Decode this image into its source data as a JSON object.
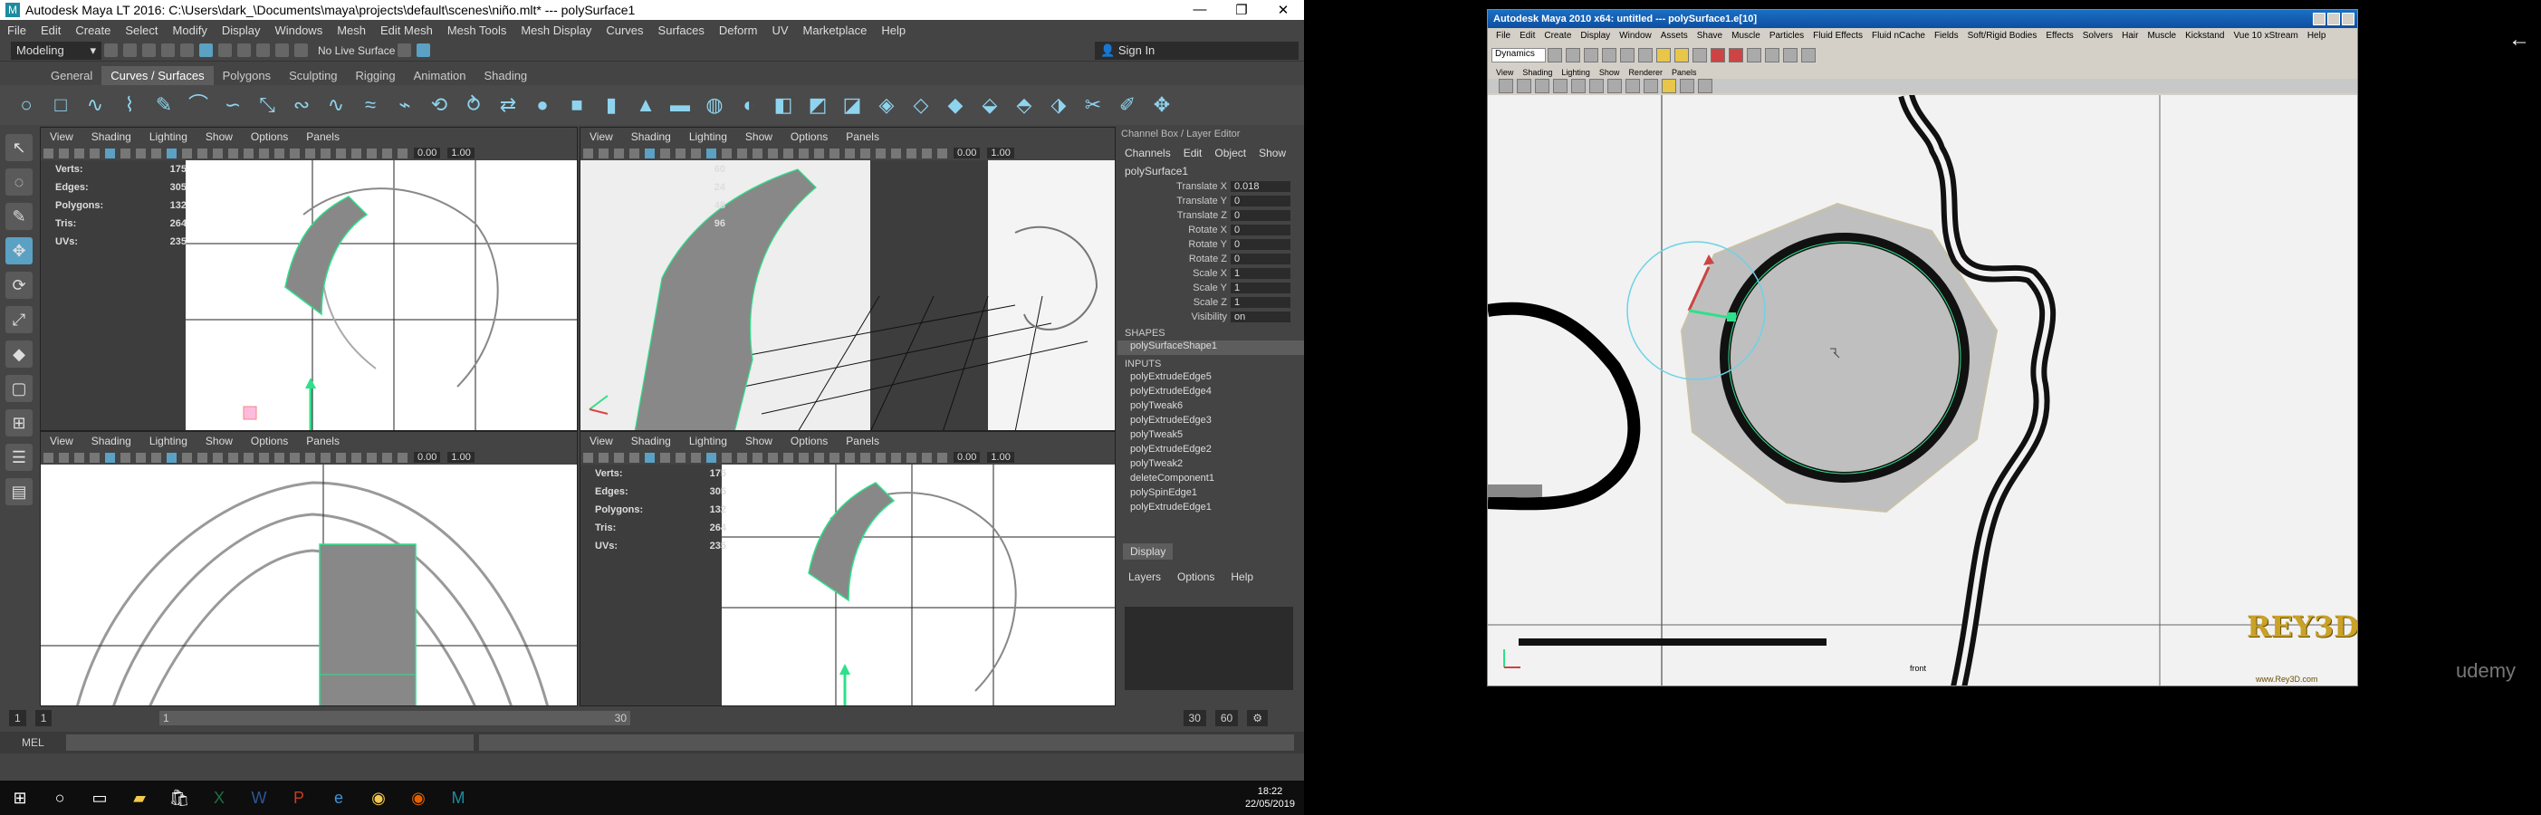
{
  "maya_lt": {
    "title": "Autodesk Maya LT 2016: C:\\Users\\dark_\\Documents\\maya\\projects\\default\\scenes\\niño.mlt*   ---   polySurface1",
    "window_buttons": [
      "—",
      "❐",
      "✕"
    ],
    "menu": [
      "File",
      "Edit",
      "Create",
      "Select",
      "Modify",
      "Display",
      "Windows",
      "Mesh",
      "Edit Mesh",
      "Mesh Tools",
      "Mesh Display",
      "Curves",
      "Surfaces",
      "Deform",
      "UV",
      "Marketplace",
      "Help"
    ],
    "status": {
      "mode": "Modeling",
      "live_surface": "No Live Surface",
      "sign_in": "Sign In"
    },
    "shelf_tabs": [
      "General",
      "Curves / Surfaces",
      "Polygons",
      "Sculpting",
      "Rigging",
      "Animation",
      "Shading"
    ],
    "shelf_active": "Curves / Surfaces",
    "viewport_menu": [
      "View",
      "Shading",
      "Lighting",
      "Show",
      "Options",
      "Panels"
    ],
    "viewport_nums": [
      "0.00",
      "1.00"
    ],
    "hud": {
      "labels": [
        "Verts:",
        "Edges:",
        "Polygons:",
        "Tris:",
        "UVs:"
      ],
      "values": [
        "175",
        "305",
        "132",
        "264",
        "235"
      ]
    },
    "persp_hud_values": [
      "60",
      "24",
      "48",
      "96"
    ],
    "channel_box": {
      "title": "Channel Box / Layer Editor",
      "menu": [
        "Channels",
        "Edit",
        "Object",
        "Show"
      ],
      "object": "polySurface1",
      "attributes": [
        {
          "name": "Translate X",
          "value": "0.018"
        },
        {
          "name": "Translate Y",
          "value": "0"
        },
        {
          "name": "Translate Z",
          "value": "0"
        },
        {
          "name": "Rotate X",
          "value": "0"
        },
        {
          "name": "Rotate Y",
          "value": "0"
        },
        {
          "name": "Rotate Z",
          "value": "0"
        },
        {
          "name": "Scale X",
          "value": "1"
        },
        {
          "name": "Scale Y",
          "value": "1"
        },
        {
          "name": "Scale Z",
          "value": "1"
        },
        {
          "name": "Visibility",
          "value": "on"
        }
      ],
      "shapes_label": "SHAPES",
      "shapes": [
        "polySurfaceShape1"
      ],
      "inputs_label": "INPUTS",
      "inputs": [
        "polyExtrudeEdge5",
        "polyExtrudeEdge4",
        "polyTweak6",
        "polyExtrudeEdge3",
        "polyTweak5",
        "polyExtrudeEdge2",
        "polyTweak2",
        "deleteComponent1",
        "polySpinEdge1",
        "polyExtrudeEdge1"
      ],
      "display_tab": "Display",
      "layer_menu": [
        "Layers",
        "Options",
        "Help"
      ]
    },
    "timeline": {
      "start": "1",
      "current": "1",
      "range_start": "1",
      "range_end": "30",
      "end": "30",
      "end2": "60"
    },
    "mel_label": "MEL"
  },
  "taskbar": {
    "time": "18:22",
    "date": "22/05/2019"
  },
  "maya_2010": {
    "title": "Autodesk Maya 2010 x64: untitled    ---    polySurface1.e[10]",
    "menu": [
      "File",
      "Edit",
      "Create",
      "Display",
      "Window",
      "Assets",
      "Shave",
      "Muscle",
      "Particles",
      "Fluid Effects",
      "Fluid nCache",
      "Fields",
      "Soft/Rigid Bodies",
      "Effects",
      "Solvers",
      "Hair",
      "Muscle",
      "Kickstand",
      "Vue 10 xStream",
      "Help"
    ],
    "mode": "Dynamics",
    "panel_menu": [
      "View",
      "Shading",
      "Lighting",
      "Show",
      "Renderer",
      "Panels"
    ],
    "view_label": "front",
    "logo": "REY3D",
    "url": "www.Rey3D.com"
  },
  "watermark": "udemy",
  "colors": {
    "maya_bg": "#444444",
    "accent": "#5aa1c4",
    "selection_green": "#2ee08a",
    "gold": "#c9a227"
  }
}
